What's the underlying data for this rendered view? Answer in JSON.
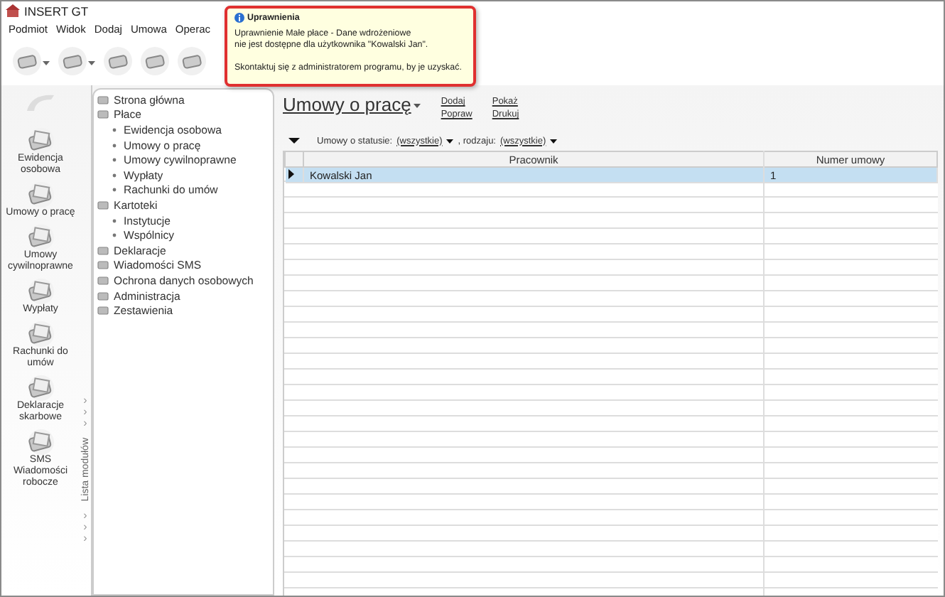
{
  "window": {
    "title": "INSERT GT"
  },
  "menu": [
    "Podmiot",
    "Widok",
    "Dodaj",
    "Umowa",
    "Operac"
  ],
  "toolbar": [
    {
      "kind": "dropdown"
    },
    {
      "kind": "dropdown"
    },
    {
      "kind": "plain"
    },
    {
      "kind": "plain"
    },
    {
      "kind": "plain"
    }
  ],
  "tooltip": {
    "title": "Uprawnienia",
    "lines": [
      "Uprawnienie Małe płace - Dane wdrożeniowe",
      "nie jest dostępne dla użytkownika \"Kowalski Jan\"."
    ],
    "note": "Skontaktuj się z administratorem programu, by je uzyskać."
  },
  "sidebar": {
    "items": [
      {
        "label": "Ewidencja osobowa"
      },
      {
        "label": "Umowy o pracę"
      },
      {
        "label": "Umowy cywilnoprawne"
      },
      {
        "label": "Wypłaty"
      },
      {
        "label": "Rachunki do umów"
      },
      {
        "label": "Deklaracje skarbowe"
      },
      {
        "label": "SMS Wiadomości robocze"
      }
    ]
  },
  "module_strip": {
    "label": "Lista modułów",
    "chevrons_top": [
      "›",
      "›",
      "›"
    ],
    "chevrons_bottom": [
      "›",
      "›",
      "›"
    ]
  },
  "tree": [
    {
      "label": "Strona główna"
    },
    {
      "label": "Płace",
      "children": [
        {
          "label": "Ewidencja osobowa"
        },
        {
          "label": "Umowy o pracę"
        },
        {
          "label": "Umowy cywilnoprawne"
        },
        {
          "label": "Wypłaty"
        },
        {
          "label": "Rachunki do umów"
        }
      ]
    },
    {
      "label": "Kartoteki",
      "children": [
        {
          "label": "Instytucje"
        },
        {
          "label": "Wspólnicy"
        }
      ]
    },
    {
      "label": "Deklaracje"
    },
    {
      "label": "Wiadomości SMS"
    },
    {
      "label": "Ochrona danych osobowych"
    },
    {
      "label": "Administracja"
    },
    {
      "label": "Zestawienia"
    }
  ],
  "content": {
    "title": "Umowy o pracę",
    "actions": [
      [
        "Dodaj",
        "Popraw"
      ],
      [
        "Pokaż",
        "Drukuj"
      ]
    ],
    "filter": {
      "label1": "Umowy o statusie:",
      "value1": "(wszystkie)",
      "label2": ", rodzaju:",
      "value2": "(wszystkie)"
    },
    "table": {
      "columns": [
        "Pracownik",
        "Numer umowy"
      ],
      "rows": [
        {
          "cells": [
            "Kowalski Jan",
            "1"
          ],
          "selected": true
        }
      ]
    }
  }
}
